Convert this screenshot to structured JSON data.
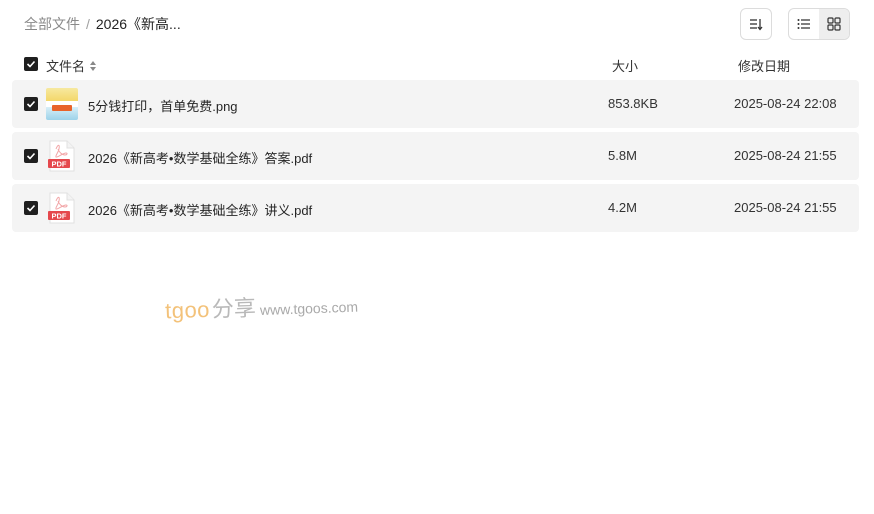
{
  "breadcrumb": {
    "root": "全部文件",
    "separator": "/",
    "current": "2026《新高..."
  },
  "toolbar": {
    "sort_icon": "sort-icon",
    "list_view_icon": "list-view-icon",
    "grid_view_icon": "grid-view-icon",
    "active_view": "list"
  },
  "table": {
    "headers": {
      "name": "文件名",
      "size": "大小",
      "date": "修改日期"
    },
    "select_all_checked": true,
    "rows": [
      {
        "checked": true,
        "type": "png",
        "name": "5分钱打印，首单免费.png",
        "size": "853.8KB",
        "date": "2025-08-24 22:08"
      },
      {
        "checked": true,
        "type": "pdf",
        "name": "2026《新高考•数学基础全练》答案.pdf",
        "size": "5.8M",
        "date": "2025-08-24 21:55"
      },
      {
        "checked": true,
        "type": "pdf",
        "name": "2026《新高考•数学基础全练》讲义.pdf",
        "size": "4.2M",
        "date": "2025-08-24 21:55"
      }
    ]
  },
  "watermark": {
    "brand": "tgoo",
    "suffix": "分享",
    "url": "www.tgoos.com"
  },
  "colors": {
    "row_background": "#f4f4f4",
    "checkbox": "#1f1f1f",
    "pdf_red": "#e5484d",
    "watermark_orange": "#f3c27a"
  }
}
